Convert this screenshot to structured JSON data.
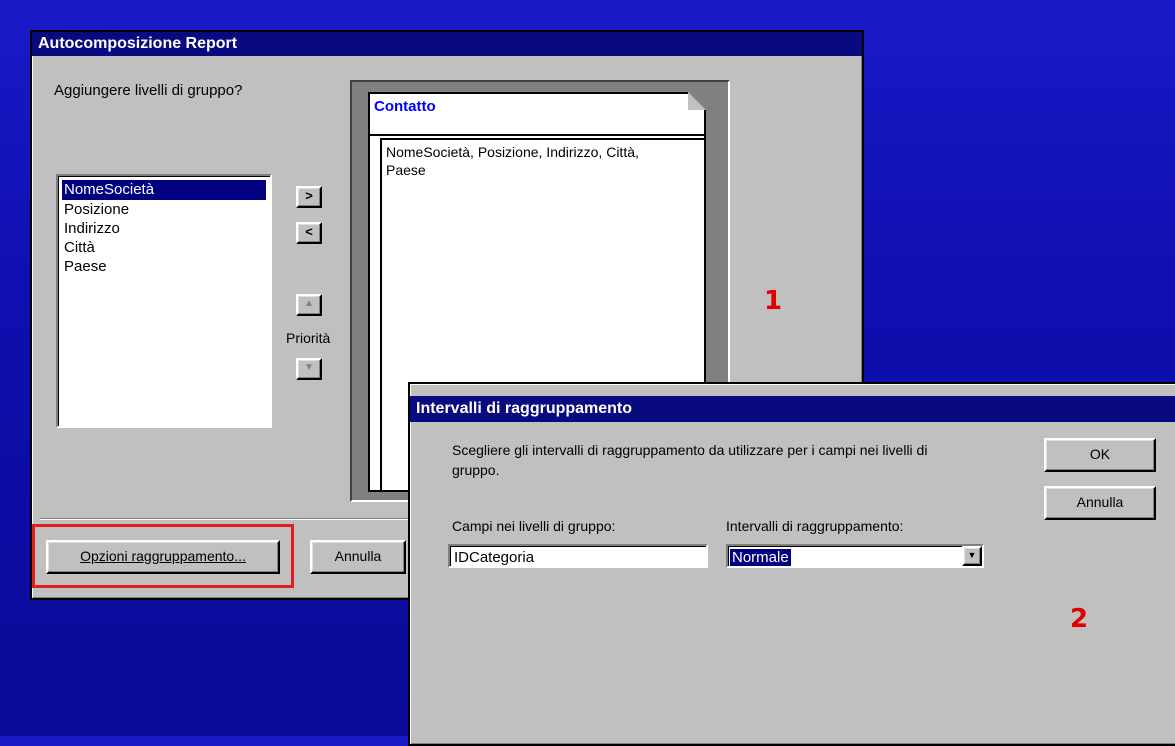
{
  "wizard": {
    "title": "Autocomposizione Report",
    "question": "Aggiungere livelli di gruppo?",
    "fields": [
      "NomeSocietà",
      "Posizione",
      "Indirizzo",
      "Città",
      "Paese"
    ],
    "add_btn": ">",
    "remove_btn": "<",
    "up_btn": "▲",
    "down_btn": "▼",
    "priority_label": "Priorità",
    "preview_group": "Contatto",
    "preview_fields_line1": "NomeSocietà, Posizione, Indirizzo, Città,",
    "preview_fields_line2": "Paese",
    "options_btn": "Opzioni raggruppamento...",
    "cancel_btn": "Annulla"
  },
  "grouping_dialog": {
    "title": "Intervalli di raggruppamento",
    "instructions_line1": "Scegliere gli intervalli di raggruppamento da utilizzare per i campi nei livelli di",
    "instructions_line2": "gruppo.",
    "fields_label": "Campi nei livelli di gruppo:",
    "field_value": "IDCategoria",
    "intervals_label": "Intervalli di raggruppamento:",
    "interval_value": "Normale",
    "ok_btn": "OK",
    "cancel_btn": "Annulla"
  },
  "annotations": {
    "label1": "1",
    "label2": "2"
  },
  "colors": {
    "highlight_box": "#e02020",
    "annotation": "#e00000",
    "title_bar": "#0a0a80"
  }
}
